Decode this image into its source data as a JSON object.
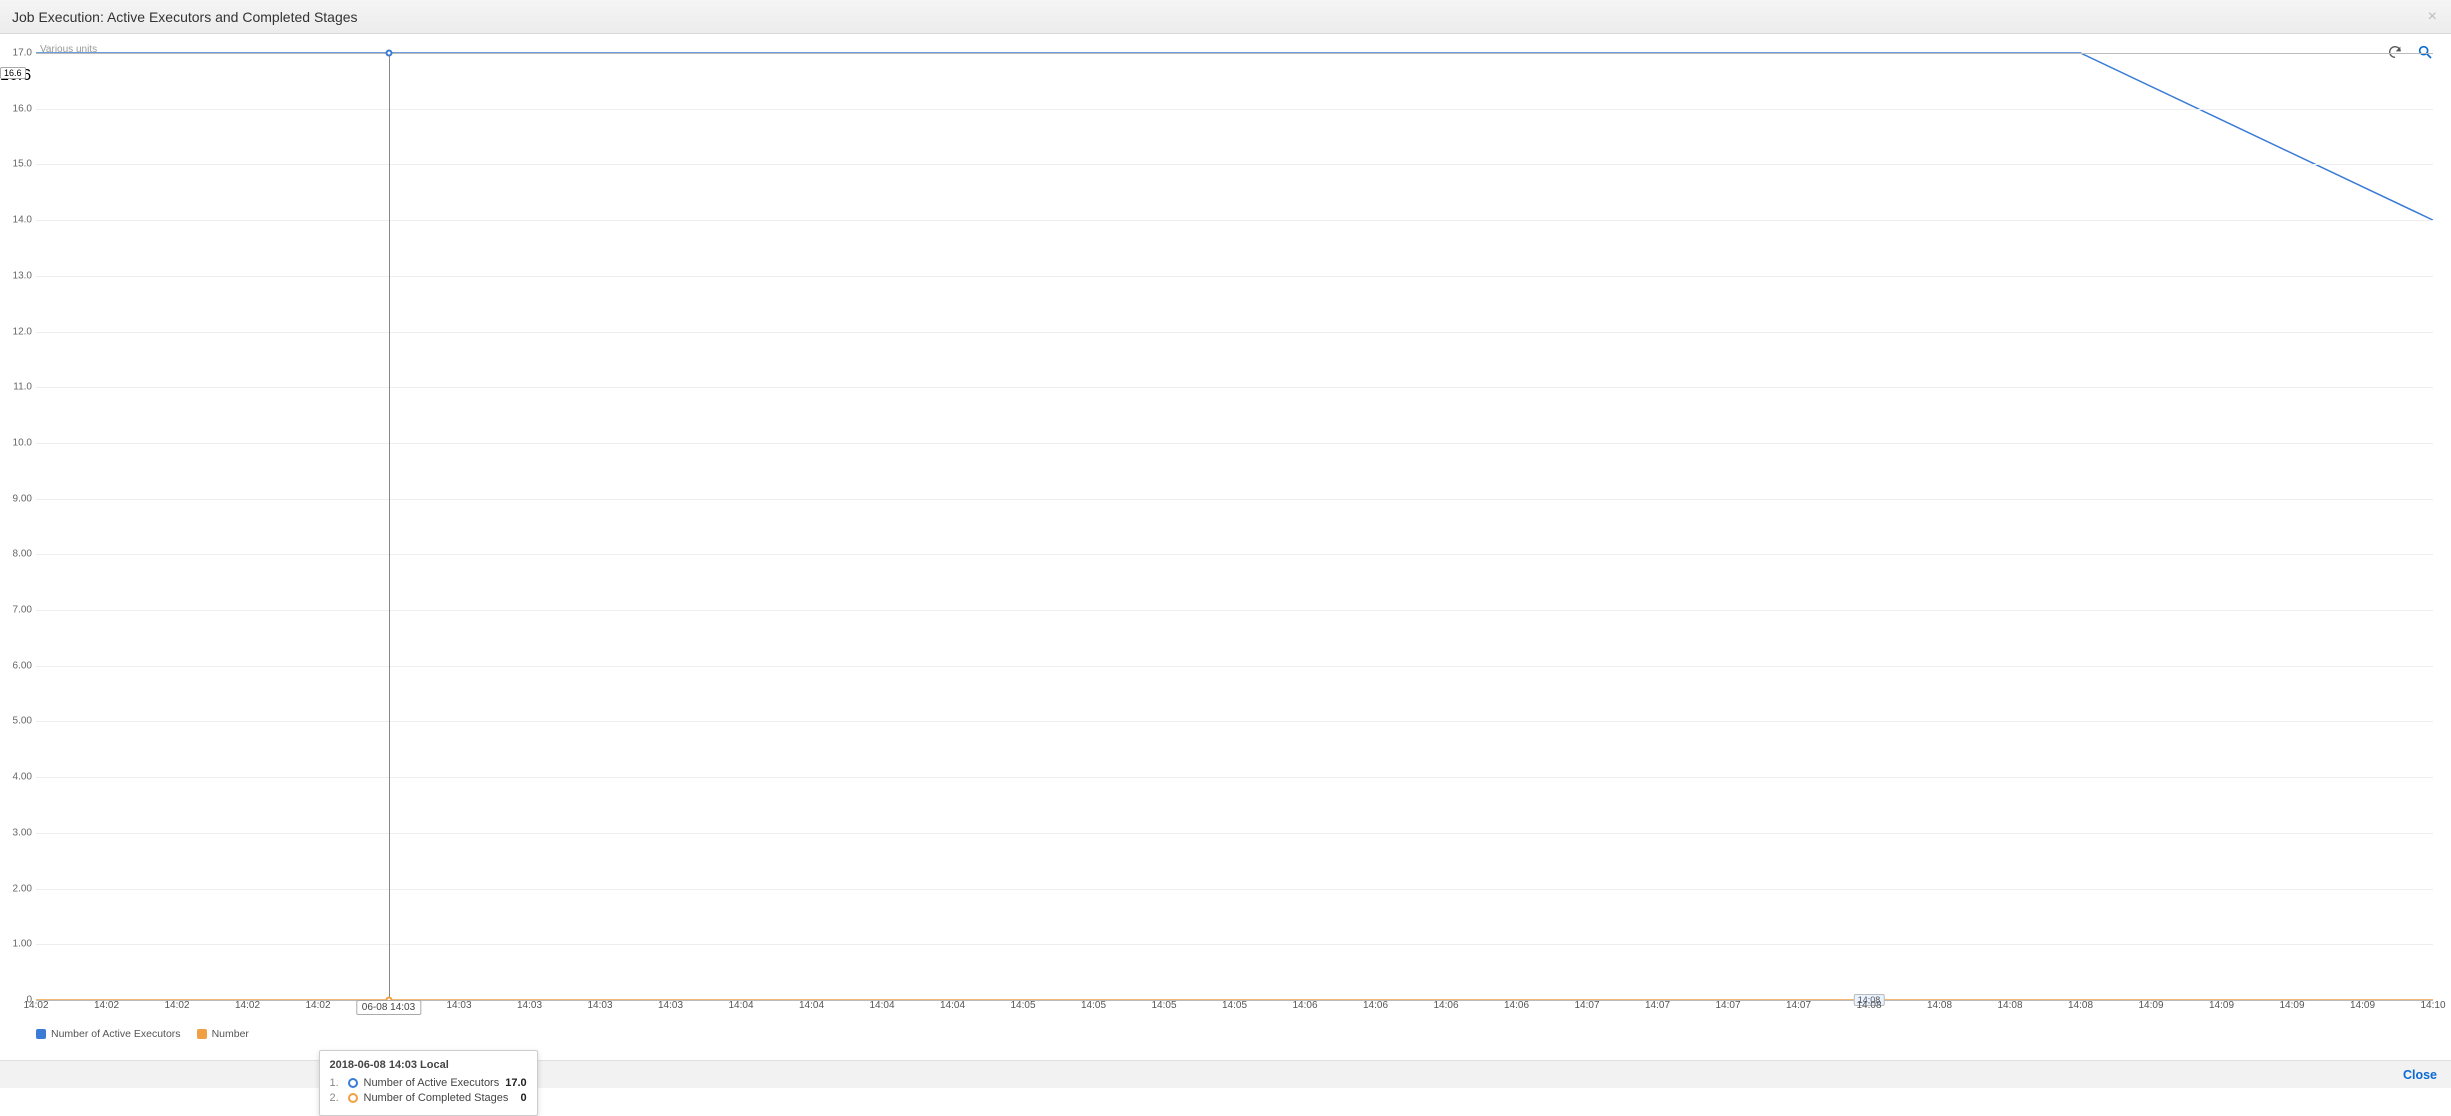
{
  "header": {
    "title": "Job Execution: Active Executors and Completed Stages"
  },
  "actions": {
    "refresh_title": "Refresh",
    "zoom_title": "Zoom"
  },
  "footer": {
    "close_label": "Close"
  },
  "chart_data": {
    "type": "line",
    "title": "Job Execution: Active Executors and Completed Stages",
    "ylabel": "Various units",
    "xlabel": "",
    "ylim": [
      0,
      17
    ],
    "y_ticks": [
      "0",
      "1.00",
      "2.00",
      "3.00",
      "4.00",
      "5.00",
      "6.00",
      "7.00",
      "8.00",
      "9.00",
      "10.0",
      "11.0",
      "12.0",
      "13.0",
      "14.0",
      "15.0",
      "16.0",
      "17.0"
    ],
    "x_ticks": [
      "14:02",
      "14:02",
      "14:02",
      "14:02",
      "14:02",
      "06-08 14:03",
      "14:03",
      "14:03",
      "14:03",
      "14:03",
      "14:04",
      "14:04",
      "14:04",
      "14:04",
      "14:05",
      "14:05",
      "14:05",
      "14:05",
      "14:06",
      "14:06",
      "14:06",
      "14:06",
      "14:07",
      "14:07",
      "14:07",
      "14:07",
      "14:08",
      "14:08",
      "14:08",
      "14:08",
      "14:09",
      "14:09",
      "14:09",
      "14:09",
      "14:10"
    ],
    "x_tick_style": [
      "plain",
      "plain",
      "plain",
      "plain",
      "plain",
      "box",
      "plain",
      "plain",
      "plain",
      "plain",
      "plain",
      "plain",
      "plain",
      "plain",
      "plain",
      "plain",
      "plain",
      "plain",
      "plain",
      "plain",
      "plain",
      "plain",
      "plain",
      "plain",
      "plain",
      "plain",
      "plain",
      "plain",
      "plain",
      "plain",
      "plain",
      "plain",
      "plain",
      "plain",
      "plain"
    ],
    "x_count": 35,
    "series": [
      {
        "name": "Number of Active Executors",
        "color": "#3a7bd5",
        "points": [
          [
            0,
            17
          ],
          [
            29,
            17
          ],
          [
            34,
            14
          ]
        ]
      },
      {
        "name": "Number of Completed Stages",
        "color": "#f0a043",
        "points": [
          [
            0,
            0
          ],
          [
            34,
            0
          ]
        ]
      }
    ],
    "hover": {
      "index": 5,
      "timestamp_label": "2018-06-08 14:03 Local",
      "y_crosshair_value": "16.6",
      "rows": [
        {
          "idx": "1.",
          "color": "#3a7bd5",
          "name": "Number of Active Executors",
          "value": "17.0"
        },
        {
          "idx": "2.",
          "color": "#f0a043",
          "name": "Number of Completed Stages",
          "value": "0"
        }
      ]
    },
    "marker_badge": {
      "index": 26,
      "label": "14:08"
    },
    "legend": [
      {
        "color": "#3a7bd5",
        "label": "Number of Active Executors"
      },
      {
        "color": "#f0a043",
        "label": "Number of Completed Stages (truncated)"
      }
    ]
  }
}
